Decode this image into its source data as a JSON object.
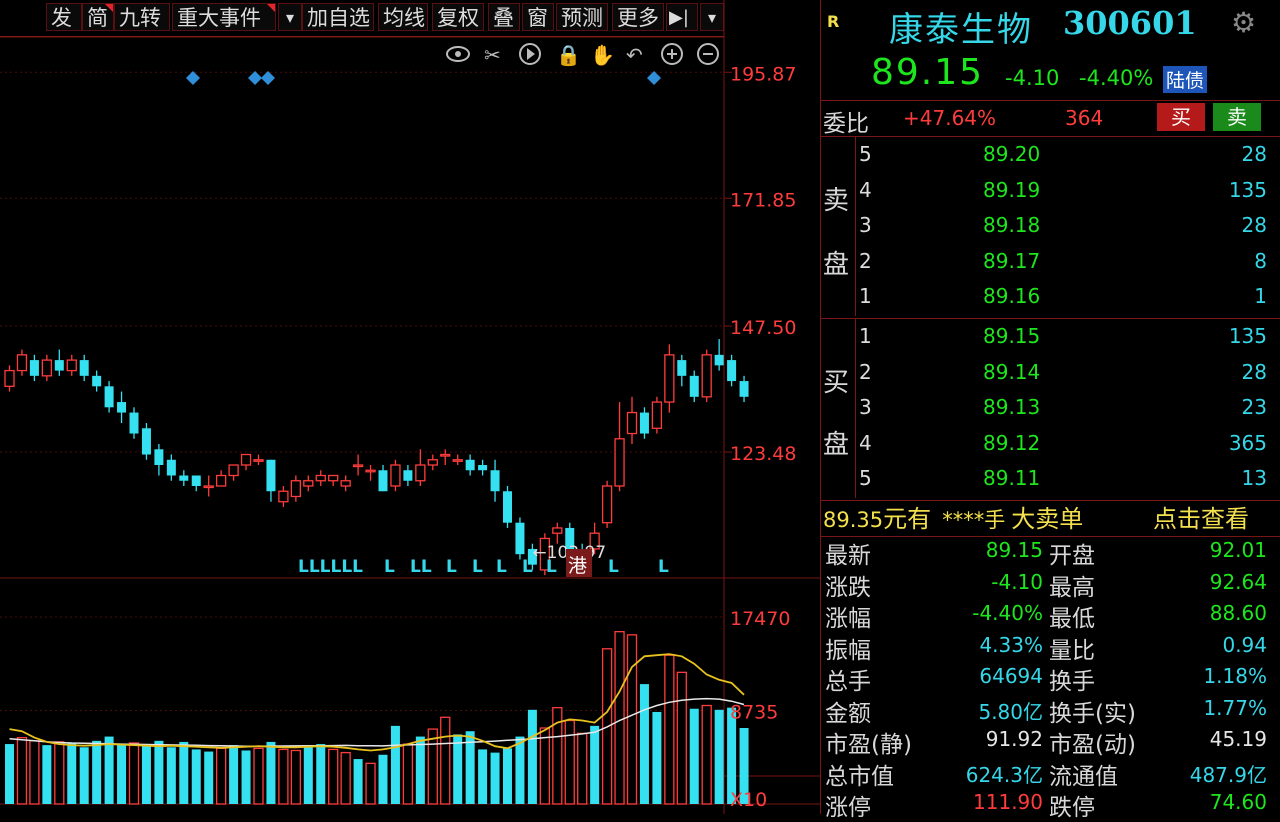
{
  "toolbar": {
    "items": [
      "发",
      "简",
      "九转",
      "重大事件",
      "▾",
      "加自选",
      "均线",
      "复权",
      "叠",
      "窗",
      "预测",
      "更多",
      "▶|",
      "▾"
    ]
  },
  "chart_icons": [
    "eye-icon",
    "scissors-icon",
    "play-icon",
    "lock-icon",
    "hand-icon",
    "undo-icon",
    "zoom-in-icon",
    "zoom-out-icon"
  ],
  "price_axis": [
    "195.87",
    "171.85",
    "147.50",
    "123.48"
  ],
  "volume_axis": [
    "17470",
    "8735",
    "X10"
  ],
  "low_marker": "←103.97",
  "hk_badge": "港",
  "l_marks": [
    "LLLLLL",
    "L",
    "LL",
    "L",
    "L",
    "L",
    "L",
    "L",
    "L",
    "L"
  ],
  "stock": {
    "r_badge": "R",
    "name": "康泰生物",
    "code": "300601",
    "price": "89.15",
    "change": "-4.10",
    "change_pct": "-4.40%",
    "connect_badge": "陆债"
  },
  "weibi": {
    "label": "委比",
    "pct": "+47.64%",
    "diff": "364",
    "buy_btn": "买",
    "sell_btn": "卖"
  },
  "sell_side": {
    "label": [
      "卖",
      "盘"
    ],
    "rows": [
      {
        "level": "5",
        "price": "89.20",
        "vol": "28"
      },
      {
        "level": "4",
        "price": "89.19",
        "vol": "135"
      },
      {
        "level": "3",
        "price": "89.18",
        "vol": "28"
      },
      {
        "level": "2",
        "price": "89.17",
        "vol": "8"
      },
      {
        "level": "1",
        "price": "89.16",
        "vol": "1"
      }
    ]
  },
  "buy_side": {
    "label": [
      "买",
      "盘"
    ],
    "rows": [
      {
        "level": "1",
        "price": "89.15",
        "vol": "135"
      },
      {
        "level": "2",
        "price": "89.14",
        "vol": "28"
      },
      {
        "level": "3",
        "price": "89.13",
        "vol": "23"
      },
      {
        "level": "4",
        "price": "89.12",
        "vol": "365"
      },
      {
        "level": "5",
        "price": "89.11",
        "vol": "13"
      }
    ]
  },
  "big_order": {
    "price": "89.35",
    "text1": "元有",
    "stars": "****手",
    "text2": "大卖单",
    "link": "点击查看"
  },
  "stats": [
    {
      "l1": "最新",
      "v1": "89.15",
      "c1": "green",
      "l2": "开盘",
      "v2": "92.01",
      "c2": "green"
    },
    {
      "l1": "涨跌",
      "v1": "-4.10",
      "c1": "green",
      "l2": "最高",
      "v2": "92.64",
      "c2": "green"
    },
    {
      "l1": "涨幅",
      "v1": "-4.40%",
      "c1": "green",
      "l2": "最低",
      "v2": "88.60",
      "c2": "green"
    },
    {
      "l1": "振幅",
      "v1": "4.33%",
      "c1": "cyan",
      "l2": "量比",
      "v2": "0.94",
      "c2": "cyan"
    },
    {
      "l1": "总手",
      "v1": "64694",
      "c1": "cyan",
      "l2": "换手",
      "v2": "1.18%",
      "c2": "cyan"
    },
    {
      "l1": "金额",
      "v1": "5.80亿",
      "c1": "cyan",
      "l2": "换手(实)",
      "v2": "1.77%",
      "c2": "cyan"
    },
    {
      "l1": "市盈(静)",
      "v1": "91.92",
      "c1": "white",
      "l2": "市盈(动)",
      "v2": "45.19",
      "c2": "white"
    },
    {
      "l1": "总市值",
      "v1": "624.3亿",
      "c1": "cyan",
      "l2": "流通值",
      "v2": "487.9亿",
      "c2": "cyan"
    },
    {
      "l1": "涨停",
      "v1": "111.90",
      "c1": "red",
      "l2": "跌停",
      "v2": "74.60",
      "c2": "green"
    }
  ],
  "colors": {
    "up": "#ff3c3c",
    "down": "#35e0f0",
    "border": "#7a1515",
    "ma1": "#e8e8e8",
    "ma2": "#e8c21e"
  },
  "chart_data": {
    "type": "candlestick",
    "price_ylim": [
      100,
      200
    ],
    "candles": [
      [
        136,
        139,
        135,
        140
      ],
      [
        139,
        142,
        138,
        143
      ],
      [
        141,
        138,
        137,
        142
      ],
      [
        138,
        141,
        137,
        142
      ],
      [
        141,
        139,
        138,
        143
      ],
      [
        139,
        141,
        138,
        142
      ],
      [
        141,
        138,
        137,
        142
      ],
      [
        138,
        136,
        135,
        139
      ],
      [
        136,
        132,
        131,
        137
      ],
      [
        133,
        131,
        129,
        135
      ],
      [
        131,
        127,
        126,
        132
      ],
      [
        128,
        123,
        122,
        129
      ],
      [
        124,
        121,
        119,
        125
      ],
      [
        122,
        119,
        118,
        123
      ],
      [
        119,
        118,
        117,
        120
      ],
      [
        119,
        117,
        116,
        119
      ],
      [
        117,
        117,
        115,
        119
      ],
      [
        117,
        119,
        117,
        120
      ],
      [
        119,
        121,
        118,
        121
      ],
      [
        121,
        123,
        120,
        123
      ],
      [
        122,
        122,
        121,
        123
      ],
      [
        122,
        116,
        114,
        122
      ],
      [
        114,
        116,
        113,
        117
      ],
      [
        115,
        118,
        114,
        119
      ],
      [
        117,
        118,
        116,
        119
      ],
      [
        118,
        119,
        117,
        120
      ],
      [
        118,
        119,
        117,
        119
      ],
      [
        117,
        118,
        116,
        119
      ],
      [
        121,
        121,
        119,
        123
      ],
      [
        120,
        120,
        118,
        121
      ],
      [
        120,
        116,
        116,
        121
      ],
      [
        117,
        121,
        116,
        122
      ],
      [
        120,
        118,
        117,
        121
      ],
      [
        118,
        121,
        117,
        124
      ],
      [
        121,
        122,
        120,
        123
      ],
      [
        123,
        123,
        121,
        124
      ],
      [
        122,
        122,
        121,
        123
      ],
      [
        122,
        120,
        119,
        123
      ],
      [
        121,
        120,
        119,
        122
      ],
      [
        120,
        116,
        114,
        122
      ],
      [
        116,
        110,
        109,
        117
      ],
      [
        110,
        104,
        103,
        111
      ],
      [
        105,
        102,
        101,
        106
      ],
      [
        101,
        107,
        100,
        108
      ],
      [
        108,
        109,
        106,
        110
      ],
      [
        109,
        104,
        103,
        110
      ],
      [
        104,
        102,
        103,
        106
      ],
      [
        105,
        108,
        104,
        110
      ],
      [
        110,
        117,
        109,
        118
      ],
      [
        117,
        126,
        116,
        133
      ],
      [
        127,
        131,
        125,
        134
      ],
      [
        131,
        127,
        126,
        132
      ],
      [
        128,
        133,
        127,
        134
      ],
      [
        133,
        142,
        131,
        144
      ],
      [
        141,
        138,
        136,
        142
      ],
      [
        138,
        134,
        133,
        139
      ],
      [
        134,
        142,
        133,
        143
      ],
      [
        142,
        140,
        139,
        145
      ],
      [
        141,
        137,
        136,
        142
      ],
      [
        137,
        134,
        133,
        138
      ]
    ],
    "volume_ylim": [
      0,
      17470
    ],
    "volumes": [
      {
        "v": 5600,
        "up": false
      },
      {
        "v": 6200,
        "up": true
      },
      {
        "v": 5900,
        "up": true
      },
      {
        "v": 5500,
        "up": false
      },
      {
        "v": 5800,
        "up": true
      },
      {
        "v": 5700,
        "up": false
      },
      {
        "v": 5300,
        "up": false
      },
      {
        "v": 5900,
        "up": false
      },
      {
        "v": 6300,
        "up": false
      },
      {
        "v": 5600,
        "up": false
      },
      {
        "v": 5700,
        "up": true
      },
      {
        "v": 5400,
        "up": false
      },
      {
        "v": 5900,
        "up": false
      },
      {
        "v": 5300,
        "up": false
      },
      {
        "v": 5800,
        "up": false
      },
      {
        "v": 5100,
        "up": false
      },
      {
        "v": 4900,
        "up": false
      },
      {
        "v": 5200,
        "up": true
      },
      {
        "v": 5500,
        "up": false
      },
      {
        "v": 5000,
        "up": false
      },
      {
        "v": 5200,
        "up": true
      },
      {
        "v": 5800,
        "up": false
      },
      {
        "v": 5100,
        "up": true
      },
      {
        "v": 5000,
        "up": true
      },
      {
        "v": 5300,
        "up": false
      },
      {
        "v": 5600,
        "up": false
      },
      {
        "v": 5100,
        "up": true
      },
      {
        "v": 4800,
        "up": true
      },
      {
        "v": 4200,
        "up": false
      },
      {
        "v": 3800,
        "up": true
      },
      {
        "v": 4600,
        "up": false
      },
      {
        "v": 7300,
        "up": false
      },
      {
        "v": 5600,
        "up": true
      },
      {
        "v": 6300,
        "up": false
      },
      {
        "v": 7000,
        "up": true
      },
      {
        "v": 8100,
        "up": true
      },
      {
        "v": 6500,
        "up": false
      },
      {
        "v": 6800,
        "up": false
      },
      {
        "v": 5100,
        "up": false
      },
      {
        "v": 4800,
        "up": false
      },
      {
        "v": 5200,
        "up": false
      },
      {
        "v": 6300,
        "up": false
      },
      {
        "v": 8800,
        "up": false
      },
      {
        "v": 7100,
        "up": true
      },
      {
        "v": 9000,
        "up": true
      },
      {
        "v": 7800,
        "up": true
      },
      {
        "v": 6600,
        "up": true
      },
      {
        "v": 7300,
        "up": false
      },
      {
        "v": 14500,
        "up": true
      },
      {
        "v": 16100,
        "up": true
      },
      {
        "v": 15800,
        "up": true
      },
      {
        "v": 11200,
        "up": false
      },
      {
        "v": 8600,
        "up": false
      },
      {
        "v": 13900,
        "up": true
      },
      {
        "v": 12300,
        "up": true
      },
      {
        "v": 8900,
        "up": false
      },
      {
        "v": 9200,
        "up": true
      },
      {
        "v": 8800,
        "up": false
      },
      {
        "v": 9000,
        "up": false
      },
      {
        "v": 7100,
        "up": false
      }
    ],
    "ma_white": [
      6100,
      6000,
      5900,
      5800,
      5750,
      5700,
      5680,
      5650,
      5620,
      5600,
      5580,
      5560,
      5540,
      5520,
      5500,
      5480,
      5460,
      5440,
      5420,
      5400,
      5400,
      5410,
      5420,
      5430,
      5440,
      5450,
      5460,
      5470,
      5450,
      5440,
      5430,
      5480,
      5520,
      5560,
      5600,
      5650,
      5700,
      5760,
      5820,
      5880,
      5950,
      6020,
      6100,
      6200,
      6300,
      6420,
      6550,
      6700,
      7200,
      7800,
      8300,
      8800,
      9200,
      9500,
      9700,
      9800,
      9850,
      9800,
      9600,
      9300
    ],
    "ma_yellow": [
      7000,
      6800,
      6200,
      5800,
      5600,
      5500,
      5450,
      5500,
      5600,
      5550,
      5500,
      5450,
      5400,
      5450,
      5400,
      5350,
      5300,
      5250,
      5300,
      5350,
      5400,
      5350,
      5300,
      5300,
      5350,
      5400,
      5350,
      5250,
      5100,
      5000,
      5100,
      5300,
      5600,
      5900,
      6100,
      6300,
      6400,
      6300,
      5900,
      5400,
      5200,
      5700,
      6300,
      6900,
      7600,
      7900,
      7800,
      7600,
      8600,
      10500,
      12800,
      13800,
      13900,
      14000,
      13800,
      13100,
      12100,
      11600,
      11300,
      10200
    ]
  }
}
